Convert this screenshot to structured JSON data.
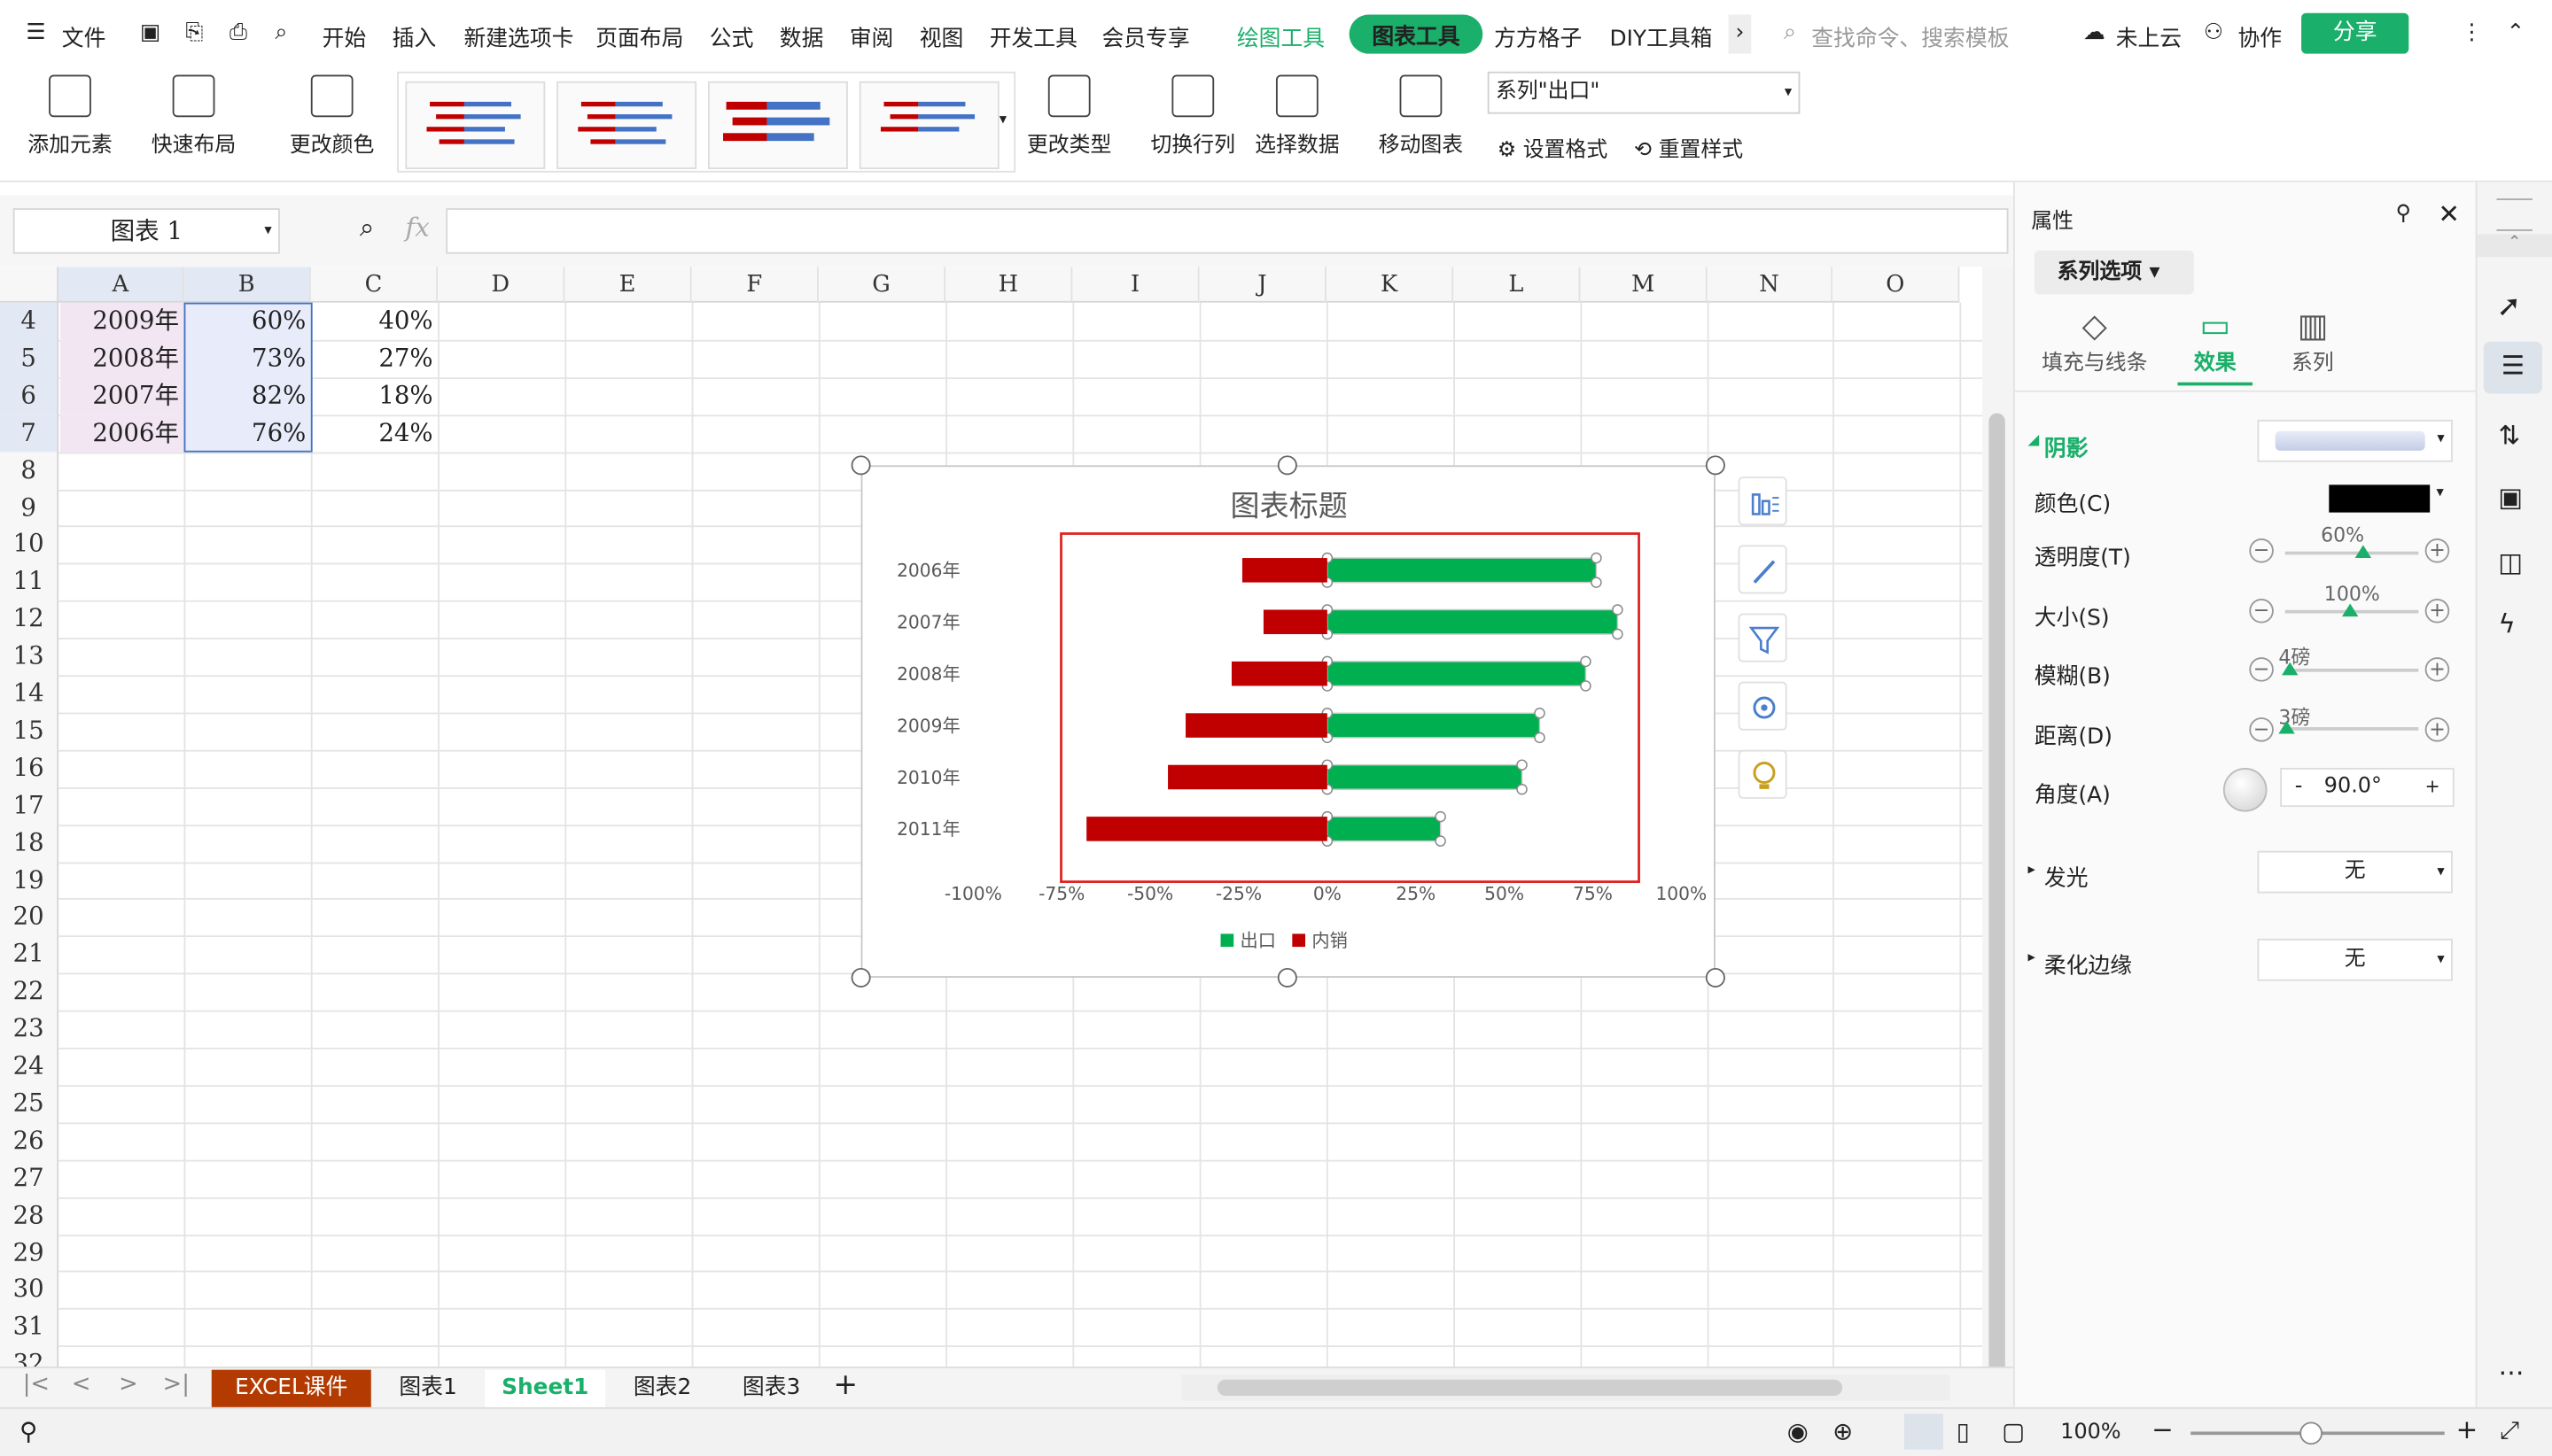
{
  "menu": {
    "file": "文件",
    "items": [
      "开始",
      "插入",
      "新建选项卡",
      "页面布局",
      "公式",
      "数据",
      "审阅",
      "视图",
      "开发工具",
      "会员专享"
    ],
    "drawing_tools": "绘图工具",
    "chart_tools": "图表工具",
    "fangfang": "方方格子",
    "diy": "DIY工具箱",
    "search": "查找命令、搜索模板",
    "cloud": "未上云",
    "collab": "协作",
    "share": "分享"
  },
  "ribbon": {
    "add_element": "添加元素",
    "quick_layout": "快速布局",
    "change_color": "更改颜色",
    "change_type": "更改类型",
    "switch_rowcol": "切换行列",
    "select_data": "选择数据",
    "move_chart": "移动图表",
    "series_select": "系列\"出口\"",
    "set_format": "设置格式",
    "reset_style": "重置样式"
  },
  "formula_bar": {
    "name_box": "图表 1",
    "fx": "fx"
  },
  "columns": [
    "A",
    "B",
    "C",
    "D",
    "E",
    "F",
    "G",
    "H",
    "I",
    "J",
    "K",
    "L",
    "M",
    "N",
    "O"
  ],
  "rows": [
    "4",
    "5",
    "6",
    "7",
    "8",
    "9",
    "10",
    "11",
    "12",
    "13",
    "14",
    "15",
    "16",
    "17",
    "18",
    "19",
    "20",
    "21",
    "22",
    "23",
    "24",
    "25",
    "26",
    "27",
    "28",
    "29",
    "30",
    "31",
    "32"
  ],
  "cells": [
    {
      "a": "2009年",
      "b": "60%",
      "c": "40%"
    },
    {
      "a": "2008年",
      "b": "73%",
      "c": "27%"
    },
    {
      "a": "2007年",
      "b": "82%",
      "c": "18%"
    },
    {
      "a": "2006年",
      "b": "76%",
      "c": "24%"
    }
  ],
  "chart_data": {
    "type": "bar",
    "title": "图表标题",
    "categories": [
      "2006年",
      "2007年",
      "2008年",
      "2009年",
      "2010年",
      "2011年"
    ],
    "series": [
      {
        "name": "出口",
        "color": "#00b050",
        "values": [
          76,
          82,
          73,
          60,
          55,
          32
        ]
      },
      {
        "name": "内销",
        "color": "#c00000",
        "values": [
          -24,
          -18,
          -27,
          -40,
          -45,
          -68
        ]
      }
    ],
    "x_ticks": [
      "-100%",
      "-75%",
      "-50%",
      "-25%",
      "0%",
      "25%",
      "50%",
      "75%",
      "100%"
    ],
    "xlim": [
      -100,
      100
    ],
    "legend": "bottom",
    "grid": false
  },
  "panel": {
    "title": "属性",
    "series_options": "系列选项",
    "tab_fill": "填充与线条",
    "tab_effect": "效果",
    "tab_series": "系列",
    "shadow": "阴影",
    "color": "颜色(C)",
    "transparency": "透明度(T)",
    "transparency_val": "60%",
    "size": "大小(S)",
    "size_val": "100%",
    "blur": "模糊(B)",
    "blur_val": "4磅",
    "distance": "距离(D)",
    "distance_val": "3磅",
    "angle": "角度(A)",
    "angle_val": "90.0°",
    "glow": "发光",
    "glow_val": "无",
    "soft_edge": "柔化边缘",
    "soft_edge_val": "无"
  },
  "sheets": [
    "EXCEL课件",
    "图表1",
    "Sheet1",
    "图表2",
    "图表3"
  ],
  "status": {
    "zoom": "100%"
  }
}
